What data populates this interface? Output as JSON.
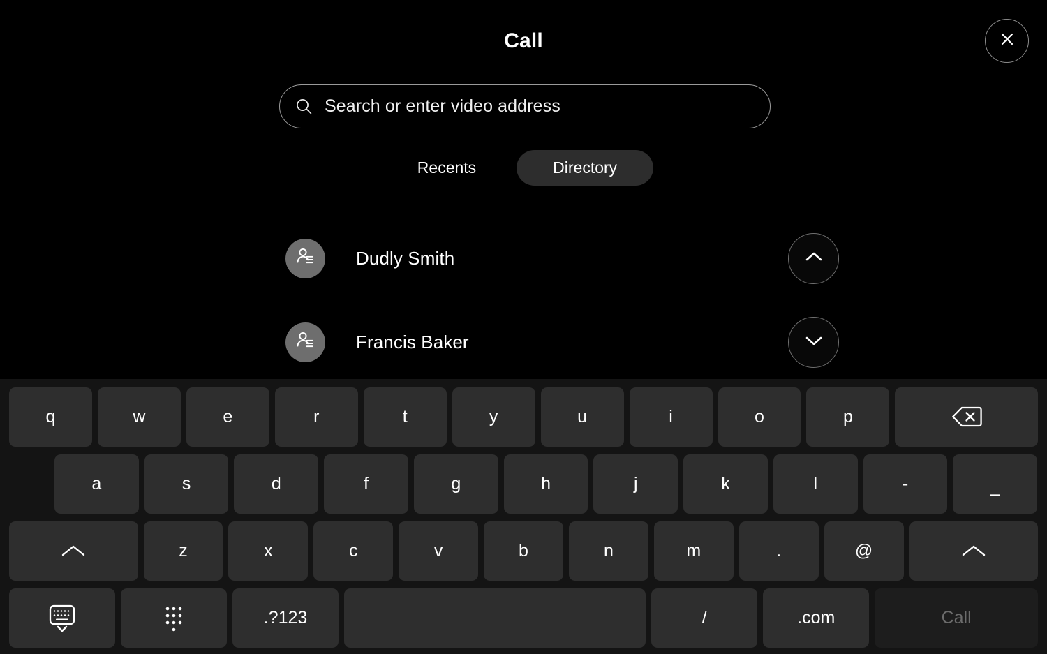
{
  "header": {
    "title": "Call",
    "close_icon": "close-icon"
  },
  "search": {
    "placeholder": "Search or enter video address",
    "value": "",
    "icon": "search-icon"
  },
  "tabs": [
    {
      "label": "Recents",
      "active": false
    },
    {
      "label": "Directory",
      "active": true
    }
  ],
  "contacts": [
    {
      "name": "Dudly Smith",
      "avatar_icon": "contact-card-icon",
      "action_icon": "chevron-up-icon"
    },
    {
      "name": "Francis Baker",
      "avatar_icon": "contact-card-icon",
      "action_icon": "chevron-down-icon"
    }
  ],
  "keyboard": {
    "row1": [
      {
        "label": "q"
      },
      {
        "label": "w"
      },
      {
        "label": "e"
      },
      {
        "label": "r"
      },
      {
        "label": "t"
      },
      {
        "label": "y"
      },
      {
        "label": "u"
      },
      {
        "label": "i"
      },
      {
        "label": "o"
      },
      {
        "label": "p"
      },
      {
        "label": "",
        "icon": "backspace-icon"
      }
    ],
    "row2": [
      {
        "label": "a"
      },
      {
        "label": "s"
      },
      {
        "label": "d"
      },
      {
        "label": "f"
      },
      {
        "label": "g"
      },
      {
        "label": "h"
      },
      {
        "label": "j"
      },
      {
        "label": "k"
      },
      {
        "label": "l"
      },
      {
        "label": "-"
      },
      {
        "label": "_"
      }
    ],
    "row3": [
      {
        "label": "",
        "icon": "shift-icon"
      },
      {
        "label": "z"
      },
      {
        "label": "x"
      },
      {
        "label": "c"
      },
      {
        "label": "v"
      },
      {
        "label": "b"
      },
      {
        "label": "n"
      },
      {
        "label": "m"
      },
      {
        "label": "."
      },
      {
        "label": "@"
      },
      {
        "label": "",
        "icon": "shift-icon"
      }
    ],
    "row4": [
      {
        "label": "",
        "icon": "hide-keyboard-icon"
      },
      {
        "label": "",
        "icon": "dialpad-icon"
      },
      {
        "label": ".?123"
      },
      {
        "label": "",
        "icon": "space-key"
      },
      {
        "label": "/"
      },
      {
        "label": ".com"
      },
      {
        "label": "Call",
        "disabled": true
      }
    ]
  },
  "colors": {
    "background": "#000000",
    "keyboard_background": "#141414",
    "key_fill": "#2e2e2e",
    "key_disabled_fill": "#1d1d1d",
    "key_disabled_text": "#6c6c6c",
    "avatar_fill": "#6e6e6e",
    "active_tab_fill": "#2d2d2d",
    "outline": "#8c8c8c"
  }
}
